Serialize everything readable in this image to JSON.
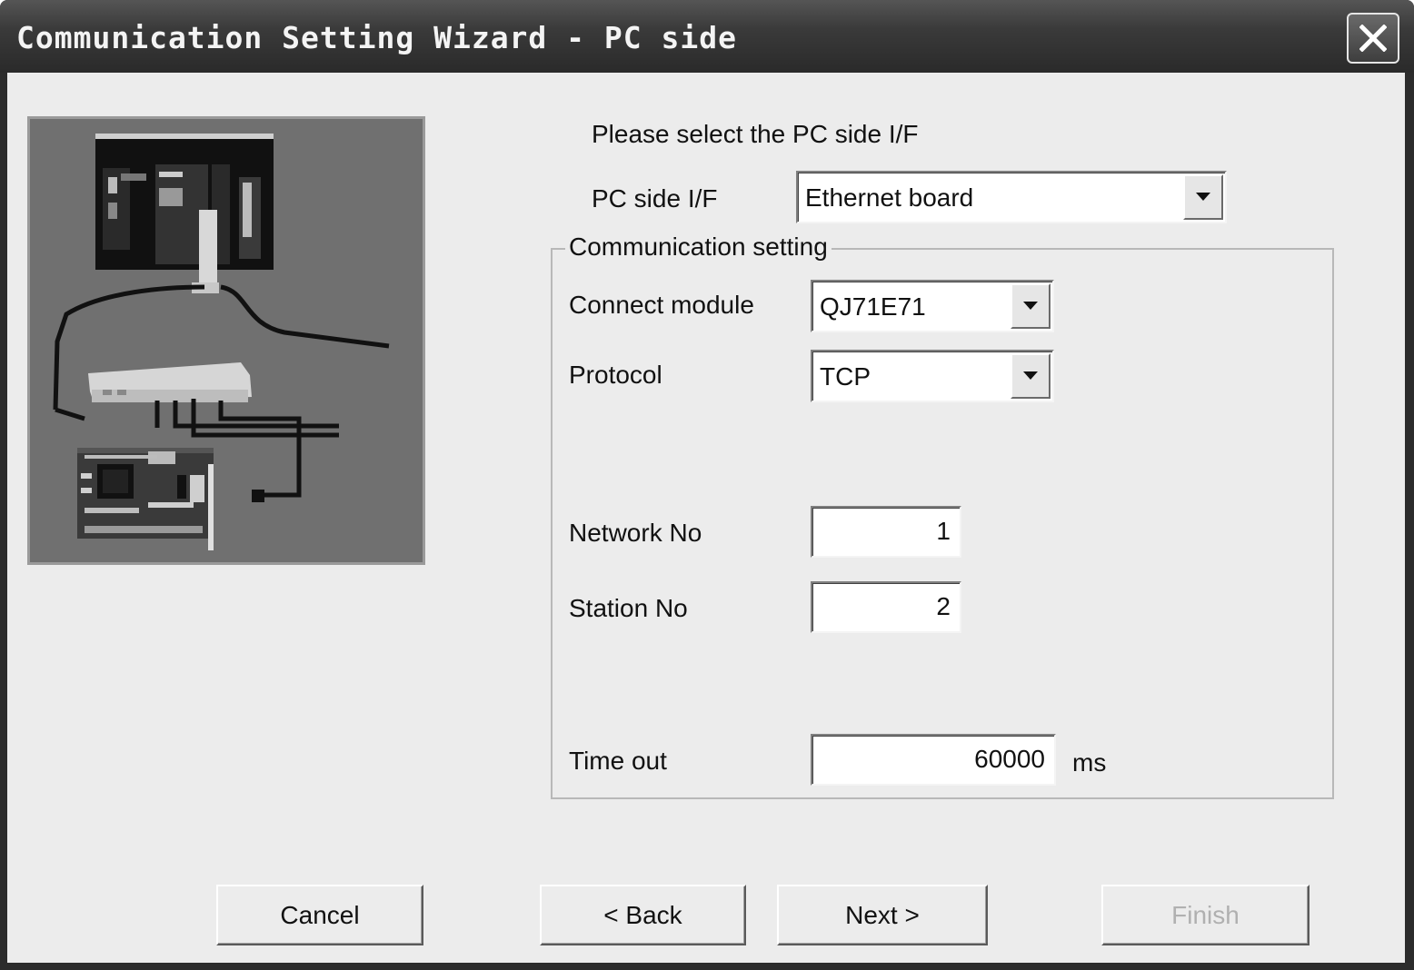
{
  "window": {
    "title": "Communication Setting Wizard - PC side"
  },
  "prompt": "Please select the PC side I/F",
  "pc_side_if": {
    "label": "PC side I/F",
    "value": "Ethernet board"
  },
  "comm_setting": {
    "legend": "Communication setting",
    "connect_module": {
      "label": "Connect module",
      "value": "QJ71E71"
    },
    "protocol": {
      "label": "Protocol",
      "value": "TCP"
    },
    "network_no": {
      "label": "Network No",
      "value": "1"
    },
    "station_no": {
      "label": "Station No",
      "value": "2"
    },
    "time_out": {
      "label": "Time out",
      "value": "60000",
      "unit": "ms"
    }
  },
  "buttons": {
    "cancel": "Cancel",
    "back": "< Back",
    "next": "Next >",
    "finish": "Finish"
  },
  "icons": {
    "close": "close-icon",
    "dropdown": "chevron-down-icon",
    "illustration": "network-diagram-illustration"
  }
}
